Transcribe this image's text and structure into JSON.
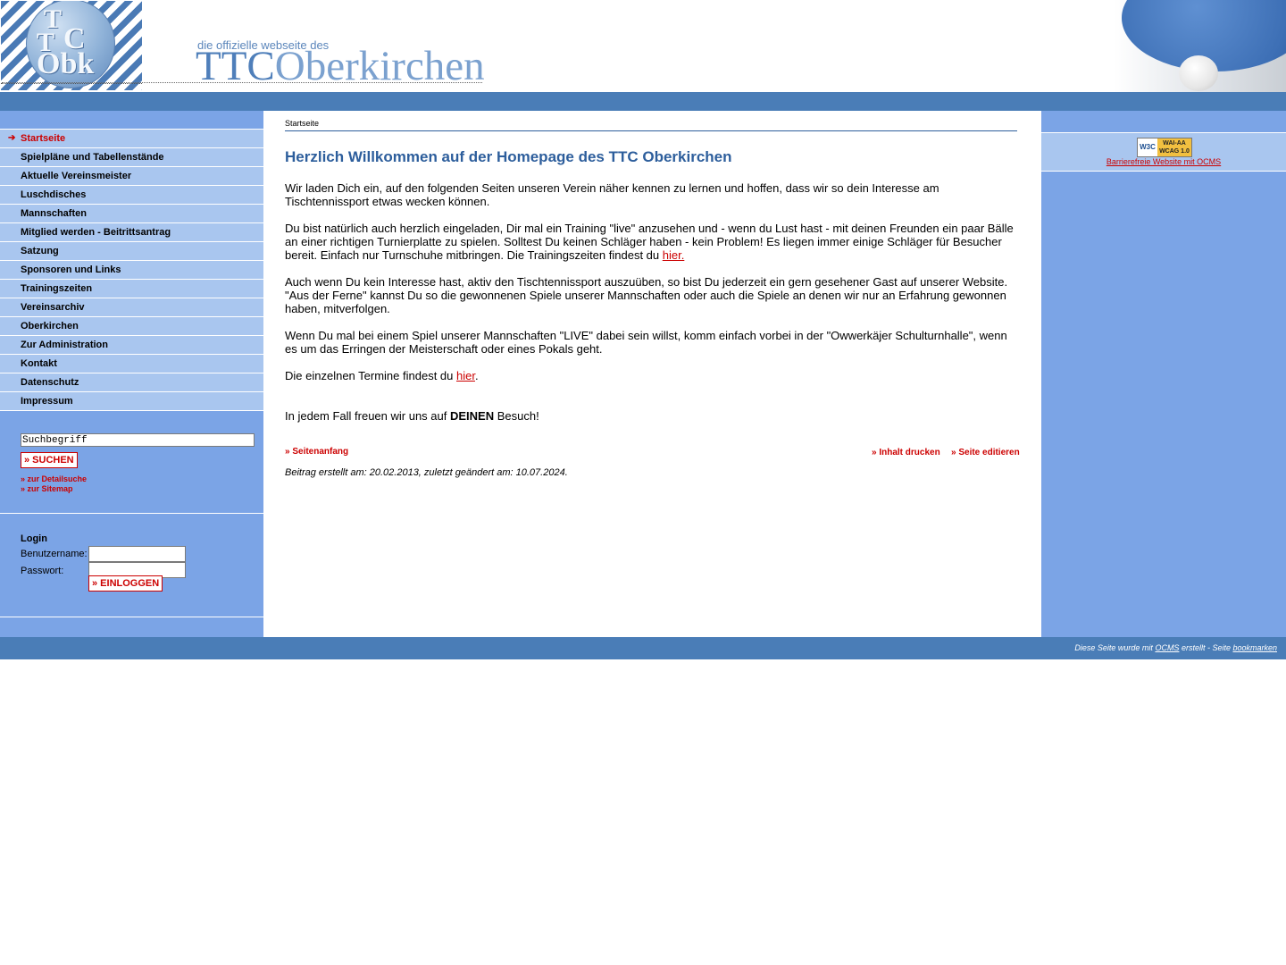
{
  "header": {
    "logo_letters": [
      "T",
      "T",
      "C",
      "Obk"
    ],
    "tagline": "die offizielle webseite des",
    "site_name_a": "TTC",
    "site_name_b": "Oberkirchen"
  },
  "nav": {
    "items": [
      {
        "label": "Startseite",
        "active": true
      },
      {
        "label": "Spielpläne und Tabellenstände"
      },
      {
        "label": "Aktuelle Vereinsmeister"
      },
      {
        "label": "Luschdisches"
      },
      {
        "label": "Mannschaften"
      },
      {
        "label": "Mitglied werden - Beitrittsantrag"
      },
      {
        "label": "Satzung"
      },
      {
        "label": "Sponsoren und Links"
      },
      {
        "label": "Trainingszeiten"
      },
      {
        "label": "Vereinsarchiv"
      },
      {
        "label": "Oberkirchen"
      },
      {
        "label": "Zur Administration"
      },
      {
        "label": "Kontakt"
      },
      {
        "label": "Datenschutz"
      },
      {
        "label": "Impressum"
      }
    ]
  },
  "search": {
    "value": "Suchbegriff",
    "button": "» SUCHEN",
    "detail_link": "» zur Detailsuche",
    "sitemap_link": "» zur Sitemap"
  },
  "login": {
    "title": "Login",
    "username_label": "Benutzername:",
    "password_label": "Passwort:",
    "button": "» EINLOGGEN"
  },
  "main": {
    "breadcrumb": "Startseite",
    "title": "Herzlich Willkommen auf der Homepage des TTC Oberkirchen",
    "p1": "Wir laden Dich ein, auf den folgenden Seiten unseren Verein näher kennen zu lernen und hoffen, dass wir so dein Interesse am Tischtennissport etwas wecken können.",
    "p2_text": "Du bist natürlich auch herzlich eingeladen, Dir mal ein Training \"live\" anzusehen und - wenn du Lust hast - mit deinen Freunden ein paar Bälle an einer richtigen Turnierplatte zu spielen. Solltest Du keinen Schläger haben - kein Problem! Es liegen immer einige Schläger für Besucher bereit. Einfach nur Turnschuhe mitbringen. Die Trainingszeiten findest du ",
    "p2_link": "hier.",
    "p3": "Auch wenn Du kein Interesse hast, aktiv den Tischtennissport auszuüben, so bist Du jederzeit ein gern gesehener Gast auf unserer Website. \"Aus der Ferne\" kannst Du so die gewonnenen Spiele unserer Mannschaften oder auch die Spiele an denen wir nur an Erfahrung gewonnen haben, mitverfolgen.",
    "p4": "Wenn Du mal bei einem Spiel unserer Mannschaften \"LIVE\" dabei sein willst, komm einfach vorbei in der \"Owwerkäjer Schulturnhalle\", wenn es um das Erringen der Meisterschaft oder eines Pokals geht.",
    "p5_text": "Die einzelnen Termine findest du ",
    "p5_link": "hier",
    "p5_end": ".",
    "p6_text": "In jedem Fall freuen wir uns auf ",
    "p6_bold": "DEINEN",
    "p6_end": " Besuch!",
    "top_link": "» Seitenanfang",
    "print_link": "» Inhalt drucken",
    "edit_link": "» Seite editieren",
    "created": "Beitrag erstellt am: 20.02.2013, zuletzt geändert am: 10.07.2024."
  },
  "right": {
    "badge_w3c": "W3C",
    "badge_wai": "WAI-AA",
    "badge_wcag": "WCAG 1.0",
    "wai_link": "Barrierefreie Website mit OCMS"
  },
  "footer": {
    "pre": "Diese Seite wurde mit ",
    "ocms": "OCMS",
    "mid": " erstellt - Seite ",
    "bookmark": "bookmarken"
  },
  "colors": {
    "accent_blue": "#4a7db7",
    "nav_bg": "#a9c6ef",
    "panel_bg": "#7ba4e6",
    "link_red": "#cc0000",
    "title_blue": "#2d5e9c"
  }
}
